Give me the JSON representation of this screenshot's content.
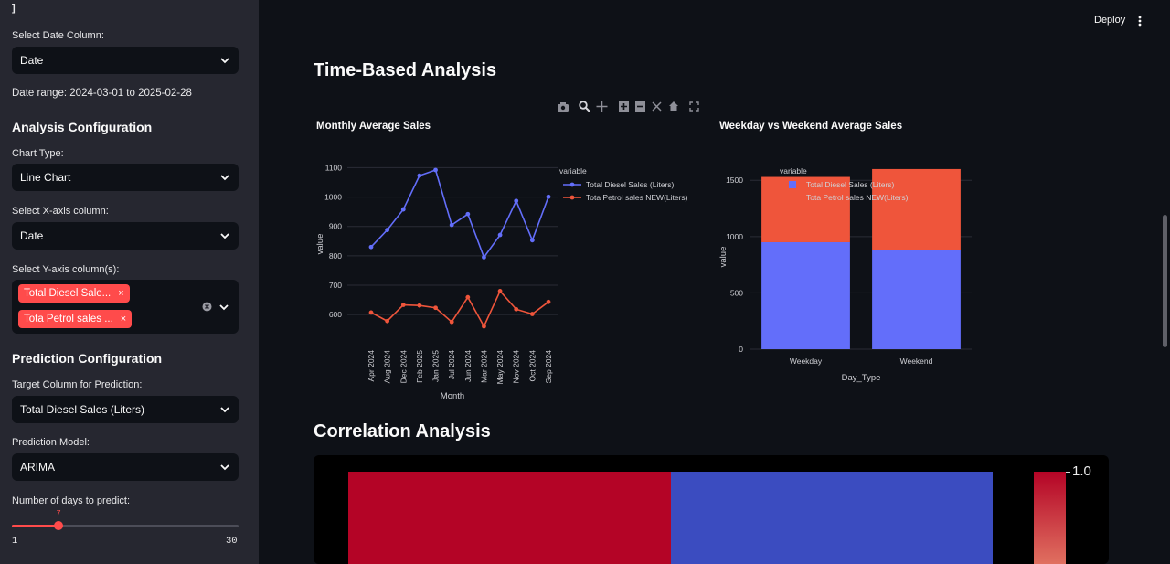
{
  "sidebar": {
    "top_bracket": "]",
    "date_column_label": "Select Date Column:",
    "date_column_value": "Date",
    "date_range": "Date range: 2024-03-01 to 2025-02-28",
    "analysis_heading": "Analysis Configuration",
    "chart_type_label": "Chart Type:",
    "chart_type_value": "Line Chart",
    "x_axis_label": "Select X-axis column:",
    "x_axis_value": "Date",
    "y_axis_label": "Select Y-axis column(s):",
    "y_axis_tags": [
      "Total Diesel Sale...",
      "Tota Petrol sales ..."
    ],
    "prediction_heading": "Prediction Configuration",
    "target_label": "Target Column for Prediction:",
    "target_value": "Total Diesel Sales (Liters)",
    "model_label": "Prediction Model:",
    "model_value": "ARIMA",
    "days_label": "Number of days to predict:",
    "days_value": "7",
    "days_min": "1",
    "days_max": "30",
    "days_fraction": 0.207
  },
  "header": {
    "deploy_label": "Deploy"
  },
  "main": {
    "section1_title": "Time-Based Analysis",
    "section2_title": "Correlation Analysis",
    "colorbar_label": "1.0"
  },
  "colors": {
    "accent": "#ff4b4b",
    "diesel": "#636efa",
    "petrol": "#ef553b",
    "heat_red": "#b40426",
    "heat_blue": "#3b4cc0"
  },
  "chart_data": [
    {
      "type": "line",
      "title": "Monthly Average Sales",
      "xlabel": "Month",
      "ylabel": "value",
      "legend_title": "variable",
      "legend_position": "top-right",
      "categories": [
        "Apr 2024",
        "Aug 2024",
        "Dec 2024",
        "Feb 2025",
        "Jan 2025",
        "Jul 2024",
        "Jun 2024",
        "Mar 2024",
        "May 2024",
        "Nov 2024",
        "Oct 2024",
        "Sep 2024"
      ],
      "yticks": [
        600,
        700,
        800,
        900,
        1000,
        1100
      ],
      "ylim": [
        560,
        1120
      ],
      "series": [
        {
          "name": "Total Diesel Sales (Liters)",
          "values": [
            830,
            888,
            958,
            1073,
            1092,
            905,
            942,
            795,
            871,
            987,
            853,
            1001
          ]
        },
        {
          "name": "Tota Petrol sales  NEW(Liters)",
          "values": [
            607,
            578,
            633,
            631,
            623,
            575,
            659,
            560,
            680,
            618,
            602,
            643
          ]
        }
      ]
    },
    {
      "type": "bar",
      "stacked": true,
      "title": "Weekday vs Weekend Average Sales",
      "xlabel": "Day_Type",
      "ylabel": "value",
      "legend_title": "variable",
      "legend_position": "top-right",
      "categories": [
        "Weekday",
        "Weekend"
      ],
      "yticks": [
        0,
        500,
        1000,
        1500
      ],
      "ylim": [
        0,
        1640
      ],
      "series": [
        {
          "name": "Total Diesel Sales (Liters)",
          "values": [
            950,
            880
          ]
        },
        {
          "name": "Tota Petrol sales  NEW(Liters)",
          "values": [
            580,
            720
          ]
        }
      ]
    }
  ]
}
